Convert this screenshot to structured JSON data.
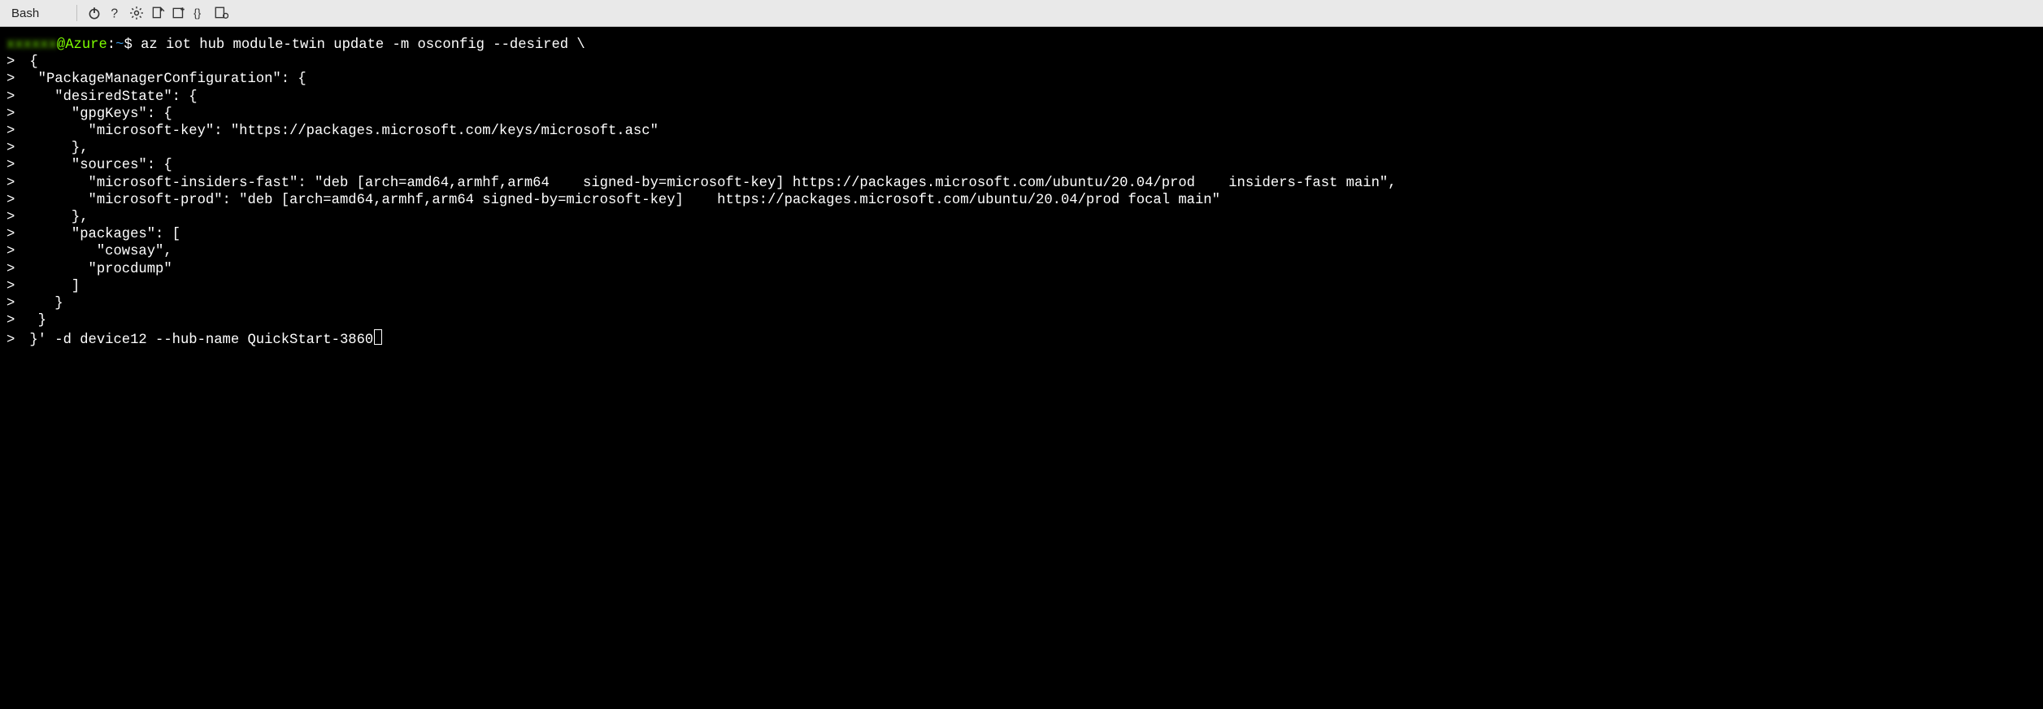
{
  "toolbar": {
    "shell_label": "Bash"
  },
  "terminal": {
    "user_blurred": "xxxxxx",
    "at_host": "@Azure",
    "path_sep": ":",
    "path": "~",
    "prompt_sym": "$",
    "first_cmd": " az iot hub module-twin update -m osconfig --desired \\",
    "lines": [
      " {",
      "  \"PackageManagerConfiguration\": {",
      "    \"desiredState\": {",
      "      \"gpgKeys\": {",
      "        \"microsoft-key\": \"https://packages.microsoft.com/keys/microsoft.asc\"",
      "      },",
      "      \"sources\": {",
      "        \"microsoft-insiders-fast\": \"deb [arch=amd64,armhf,arm64    signed-by=microsoft-key] https://packages.microsoft.com/ubuntu/20.04/prod    insiders-fast main\",",
      "        \"microsoft-prod\": \"deb [arch=amd64,armhf,arm64 signed-by=microsoft-key]    https://packages.microsoft.com/ubuntu/20.04/prod focal main\"",
      "      },",
      "      \"packages\": [",
      "         \"cowsay\",",
      "        \"procdump\"",
      "      ]",
      "    }",
      "  }"
    ],
    "last_line": " }' -d device12 --hub-name QuickStart-3860"
  },
  "chart_data": null
}
